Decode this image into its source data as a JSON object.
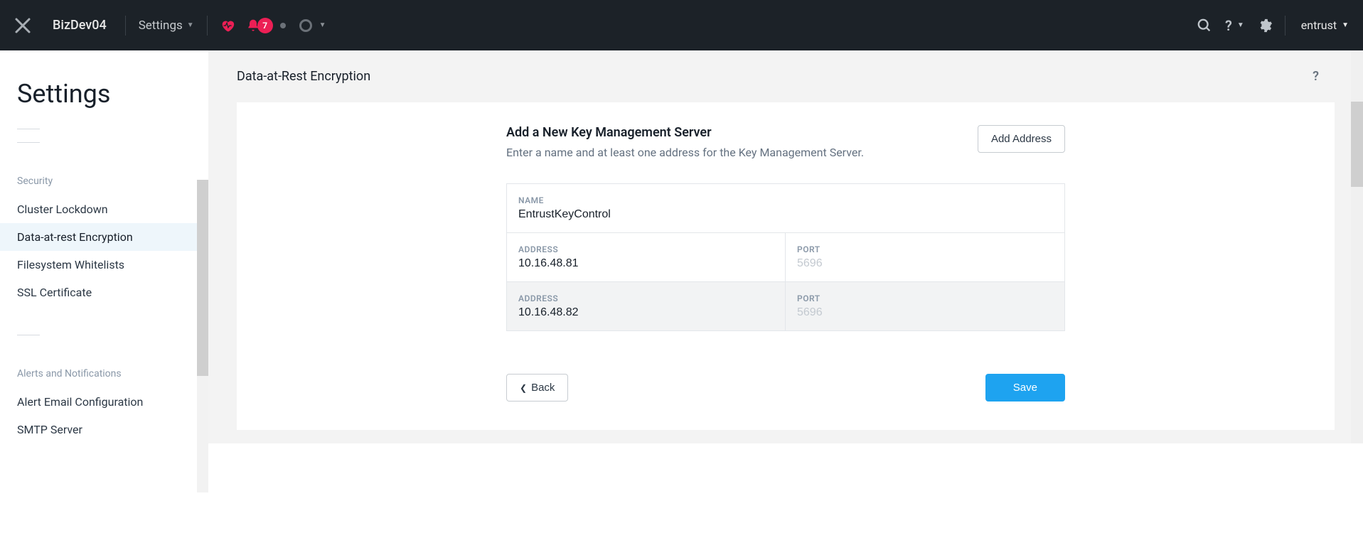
{
  "header": {
    "org": "BizDev04",
    "nav_dropdown": "Settings",
    "notif_count": "7",
    "user": "entrust"
  },
  "sidebar": {
    "title": "Settings",
    "group_security": "Security",
    "items_security": {
      "cluster_lockdown": "Cluster Lockdown",
      "data_at_rest": "Data-at-rest Encryption",
      "fs_whitelists": "Filesystem Whitelists",
      "ssl_cert": "SSL Certificate"
    },
    "group_alerts": "Alerts and Notifications",
    "items_alerts": {
      "alert_email": "Alert Email Configuration",
      "smtp": "SMTP Server"
    }
  },
  "main": {
    "page_title": "Data-at-Rest Encryption",
    "card_title": "Add a New Key Management Server",
    "card_subtitle": "Enter a name and at least one address for the Key Management Server.",
    "add_address_btn": "Add Address",
    "back_btn": "Back",
    "save_btn": "Save",
    "labels": {
      "name": "NAME",
      "address": "ADDRESS",
      "port": "PORT"
    },
    "values": {
      "name": "EntrustKeyControl",
      "addr1": "10.16.48.81",
      "addr2": "10.16.48.82",
      "port_placeholder": "5696"
    }
  }
}
